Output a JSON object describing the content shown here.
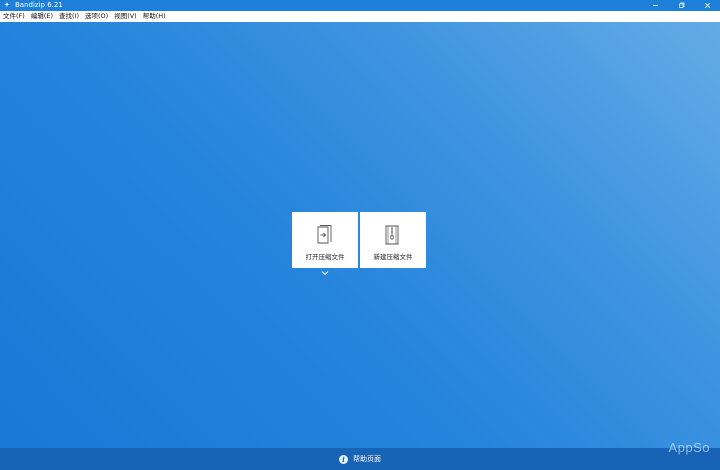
{
  "window": {
    "title": "Bandizip 6.21"
  },
  "menu": {
    "items": [
      {
        "label": "文件(F)"
      },
      {
        "label": "编辑(E)"
      },
      {
        "label": "查找(I)"
      },
      {
        "label": "选项(O)"
      },
      {
        "label": "视图(V)"
      },
      {
        "label": "帮助(H)"
      }
    ]
  },
  "actions": {
    "open": {
      "label": "打开压缩文件",
      "icon": "open-archive-icon"
    },
    "new": {
      "label": "新建压缩文件",
      "icon": "new-archive-icon"
    }
  },
  "footer": {
    "help_label": "帮助页面",
    "help_icon": "info-icon"
  },
  "watermark": {
    "text": "AppSo"
  },
  "colors": {
    "titlebar": "#1e7fd8",
    "background": "#1778d6",
    "footer": "#1763b5",
    "card": "#ffffff"
  }
}
